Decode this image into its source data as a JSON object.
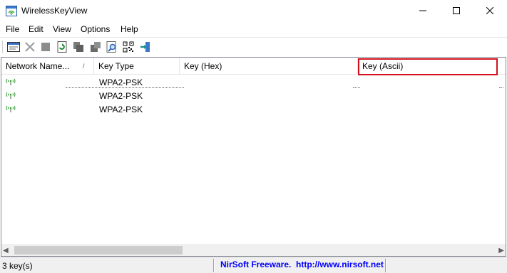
{
  "window": {
    "title": "WirelessKeyView",
    "app_icon": "wifi-app-icon",
    "controls": [
      "minimize-icon",
      "maximize-icon",
      "close-icon"
    ]
  },
  "menu": [
    "File",
    "Edit",
    "View",
    "Options",
    "Help"
  ],
  "toolbar": {
    "buttons": [
      "properties-icon",
      "delete-icon",
      "stop-icon",
      "refresh-icon",
      "copy-icon",
      "export-icon",
      "find-icon",
      "qr-code-icon",
      "exit-icon"
    ]
  },
  "columns": {
    "network_name": "Network Name...",
    "sort_indicator": "/",
    "key_type": "Key Type",
    "key_hex": "Key (Hex)",
    "key_ascii": "Key (Ascii)"
  },
  "rows": [
    {
      "network_name": "",
      "key_type": "WPA2-PSK",
      "key_hex": "",
      "key_ascii": ""
    },
    {
      "network_name": "",
      "key_type": "WPA2-PSK",
      "key_hex": "",
      "key_ascii": ""
    },
    {
      "network_name": "",
      "key_type": "WPA2-PSK",
      "key_hex": "",
      "key_ascii": ""
    }
  ],
  "row_icon": "wireless-network-icon",
  "status": {
    "count": "3 key(s)",
    "link": "NirSoft Freeware.  http://www.nirsoft.net"
  },
  "colors": {
    "highlight": "#d1121c",
    "link": "#0000ff",
    "wifi_green": "#2e9a2e"
  }
}
